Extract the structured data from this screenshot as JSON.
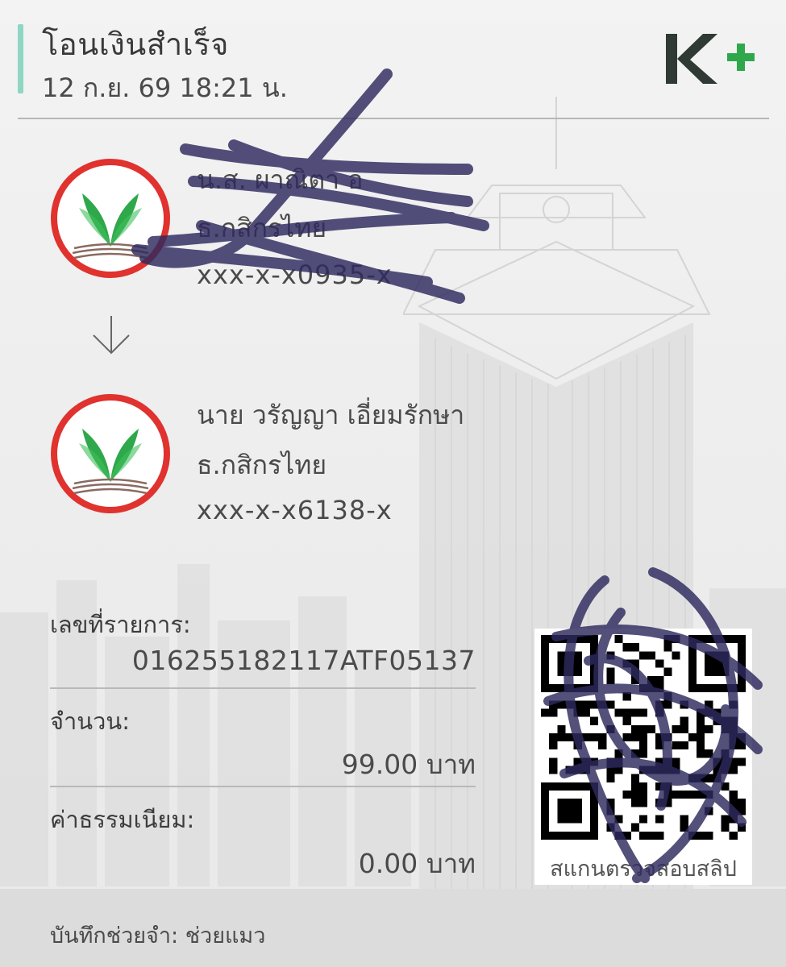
{
  "header": {
    "title": "โอนเงินสำเร็จ",
    "datetime": "12 ก.ย. 69  18:21 น.",
    "logo_text": "K+"
  },
  "sender": {
    "name": "น.ส. ผาณิตา อ",
    "bank": "ธ.กสิกรไทย",
    "account": "xxx-x-x0935-x"
  },
  "receiver": {
    "name": "นาย วรัญญา เอี่ยมรักษา",
    "bank": "ธ.กสิกรไทย",
    "account": "xxx-x-x6138-x"
  },
  "details": {
    "ref_label": "เลขที่รายการ:",
    "ref_value": "016255182117ATF05137",
    "amount_label": "จำนวน:",
    "amount_value": "99.00 บาท",
    "fee_label": "ค่าธรรมเนียม:",
    "fee_value": "0.00 บาท"
  },
  "qr": {
    "caption": "สแกนตรวจสอบสลิป"
  },
  "memo": {
    "text": "บันทึกช่วยจำ: ช่วยแมว"
  },
  "icons": {
    "bank_logo": "kbank-logo-icon",
    "arrow": "arrow-down-icon",
    "qr": "qr-code-icon"
  },
  "colors": {
    "accent": "#8fd6c4",
    "kbank_green": "#2ea84a",
    "kbank_red": "#e0322e",
    "scribble": "#2e2a5e"
  }
}
